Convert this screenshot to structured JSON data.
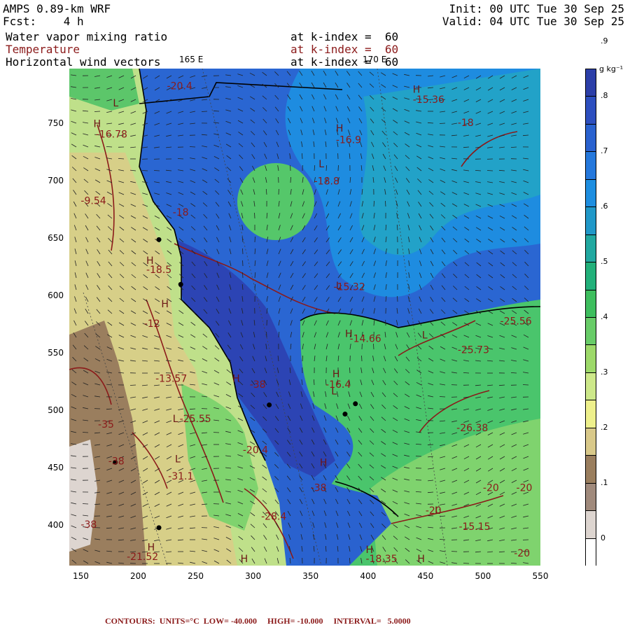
{
  "header": {
    "title": "AMPS 0.89-km WRF",
    "fcst_label": "Fcst:",
    "fcst_value": "4 h",
    "init": "Init: 00 UTC Tue 30 Sep 25",
    "valid": "Valid: 04 UTC Tue 30 Sep 25",
    "fields": [
      {
        "name": "Water vapor mixing ratio",
        "level": "at k-index =  60",
        "color": "#000000"
      },
      {
        "name": "Temperature",
        "level": "at k-index =  60",
        "color": "#8b1a1a"
      },
      {
        "name": "Horizontal wind vectors",
        "level": "at k-index =  60",
        "color": "#000000"
      }
    ]
  },
  "map": {
    "longitude_labels": [
      "165 E",
      "170 E"
    ],
    "x_ticks": [
      "150",
      "200",
      "250",
      "300",
      "350",
      "400",
      "450",
      "500",
      "550"
    ],
    "y_ticks": [
      "750",
      "700",
      "650",
      "600",
      "550",
      "500",
      "450",
      "400"
    ],
    "x_range": [
      140,
      550
    ],
    "y_range": [
      365,
      798
    ],
    "contour_labels": [
      {
        "text": "-20.4",
        "x": 225,
        "y": 780
      },
      {
        "text": "-15.36",
        "x": 439,
        "y": 768
      },
      {
        "text": "-16.78",
        "x": 163,
        "y": 738
      },
      {
        "text": "-16.9",
        "x": 372,
        "y": 733
      },
      {
        "text": "-18",
        "x": 478,
        "y": 748
      },
      {
        "text": "-18.8",
        "x": 353,
        "y": 697
      },
      {
        "text": "-9.54",
        "x": 150,
        "y": 680
      },
      {
        "text": "-18",
        "x": 230,
        "y": 670
      },
      {
        "text": "-18.5",
        "x": 207,
        "y": 620
      },
      {
        "text": "-15.32",
        "x": 370,
        "y": 605
      },
      {
        "text": "-12",
        "x": 205,
        "y": 573
      },
      {
        "text": "-25.56",
        "x": 515,
        "y": 575
      },
      {
        "text": "-14.66",
        "x": 384,
        "y": 560
      },
      {
        "text": "-25.73",
        "x": 478,
        "y": 550
      },
      {
        "text": "-13.57",
        "x": 215,
        "y": 525
      },
      {
        "text": "-38",
        "x": 297,
        "y": 520
      },
      {
        "text": "-16.4",
        "x": 363,
        "y": 520
      },
      {
        "text": "-25.55",
        "x": 236,
        "y": 490
      },
      {
        "text": "-26.38",
        "x": 477,
        "y": 482
      },
      {
        "text": "-35",
        "x": 165,
        "y": 485
      },
      {
        "text": "-20.4",
        "x": 291,
        "y": 463
      },
      {
        "text": "-38",
        "x": 174,
        "y": 453
      },
      {
        "text": "-31.1",
        "x": 226,
        "y": 440
      },
      {
        "text": "-38",
        "x": 350,
        "y": 430
      },
      {
        "text": "-20",
        "x": 500,
        "y": 430
      },
      {
        "text": "-20",
        "x": 529,
        "y": 430
      },
      {
        "text": "-28.4",
        "x": 307,
        "y": 405
      },
      {
        "text": "-20",
        "x": 450,
        "y": 410
      },
      {
        "text": "-38",
        "x": 150,
        "y": 398
      },
      {
        "text": "-15.15",
        "x": 479,
        "y": 396
      },
      {
        "text": "-21.52",
        "x": 190,
        "y": 370
      },
      {
        "text": "-18.35",
        "x": 398,
        "y": 368
      },
      {
        "text": "-20",
        "x": 527,
        "y": 373
      }
    ],
    "high_markers": [
      {
        "x": 439,
        "y": 777
      },
      {
        "x": 161,
        "y": 747
      },
      {
        "x": 372,
        "y": 743
      },
      {
        "x": 207,
        "y": 628
      },
      {
        "x": 220,
        "y": 590
      },
      {
        "x": 380,
        "y": 564
      },
      {
        "x": 369,
        "y": 529
      },
      {
        "x": 282,
        "y": 525
      },
      {
        "x": 358,
        "y": 452
      },
      {
        "x": 208,
        "y": 378
      },
      {
        "x": 289,
        "y": 368
      },
      {
        "x": 398,
        "y": 376
      },
      {
        "x": 443,
        "y": 368
      }
    ],
    "low_markers": [
      {
        "x": 178,
        "y": 765
      },
      {
        "x": 357,
        "y": 712
      },
      {
        "x": 372,
        "y": 606
      },
      {
        "x": 230,
        "y": 490
      },
      {
        "x": 232,
        "y": 455
      },
      {
        "x": 368,
        "y": 514
      },
      {
        "x": 447,
        "y": 563
      },
      {
        "x": 458,
        "y": 410
      }
    ],
    "stations": [
      {
        "x": 218,
        "y": 649
      },
      {
        "x": 237,
        "y": 610
      },
      {
        "x": 314,
        "y": 505
      },
      {
        "x": 380,
        "y": 497
      },
      {
        "x": 389,
        "y": 506
      },
      {
        "x": 180,
        "y": 455
      },
      {
        "x": 218,
        "y": 398
      }
    ]
  },
  "colorbar": {
    "unit": "g kg⁻¹",
    "labels": [
      "0",
      ".1",
      ".2",
      ".3",
      ".4",
      ".5",
      ".6",
      ".7",
      ".8",
      ".9"
    ],
    "colors": [
      "#ffffff",
      "#ddd5d0",
      "#a08a7c",
      "#9a7e5e",
      "#d9c98a",
      "#eef08c",
      "#cde88a",
      "#9dd96a",
      "#68cc68",
      "#3ebe5e",
      "#22b07a",
      "#21a8a0",
      "#2098c8",
      "#1e8ee0",
      "#2578dc",
      "#2a62cf",
      "#2d4fbf",
      "#2c3fa8"
    ]
  },
  "footer": {
    "text": "CONTOURS:  UNITS=°C  LOW= -40.000     HIGH= -10.000     INTERVAL=   5.0000"
  }
}
